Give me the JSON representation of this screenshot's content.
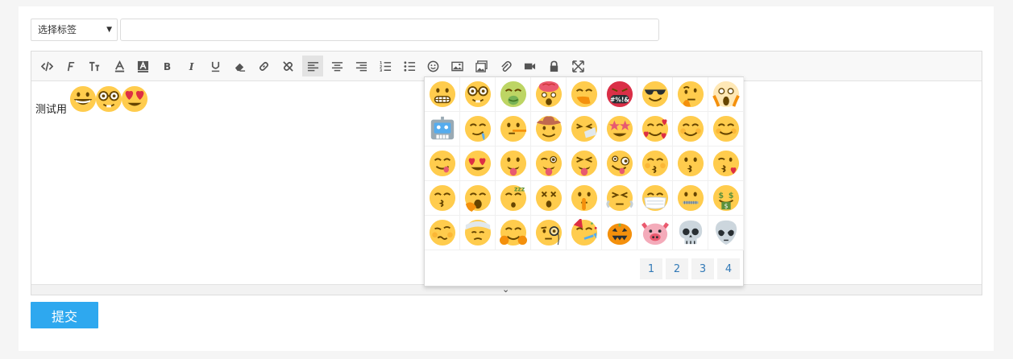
{
  "form": {
    "tag_select": {
      "selected": "选择标签",
      "caret": "▼"
    },
    "title_input": {
      "value": "",
      "placeholder": ""
    },
    "submit_label": "提交"
  },
  "toolbar": {
    "items": [
      {
        "name": "code-icon",
        "glyph": "</>"
      },
      {
        "name": "font-family-icon",
        "glyph": "F"
      },
      {
        "name": "font-size-icon",
        "glyph": "T↕"
      },
      {
        "name": "font-color-icon",
        "glyph": "A"
      },
      {
        "name": "background-color-icon",
        "glyph": "A"
      },
      {
        "name": "bold-icon",
        "glyph": "B"
      },
      {
        "name": "italic-icon",
        "glyph": "I"
      },
      {
        "name": "underline-icon",
        "glyph": "U"
      },
      {
        "name": "eraser-icon",
        "glyph": "⌫"
      },
      {
        "name": "link-icon",
        "glyph": "🔗"
      },
      {
        "name": "unlink-icon",
        "glyph": "⛓"
      },
      {
        "name": "align-left-icon",
        "glyph": "≡"
      },
      {
        "name": "align-center-icon",
        "glyph": "≡"
      },
      {
        "name": "align-right-icon",
        "glyph": "≡"
      },
      {
        "name": "ordered-list-icon",
        "glyph": "1≡"
      },
      {
        "name": "unordered-list-icon",
        "glyph": "•≡"
      },
      {
        "name": "emoji-icon",
        "glyph": "☺"
      },
      {
        "name": "image-icon",
        "glyph": "▣"
      },
      {
        "name": "gallery-icon",
        "glyph": "▤"
      },
      {
        "name": "attachment-icon",
        "glyph": "📎"
      },
      {
        "name": "video-icon",
        "glyph": "■"
      },
      {
        "name": "lock-icon",
        "glyph": "🔒"
      },
      {
        "name": "fullscreen-icon",
        "glyph": "⤢"
      }
    ],
    "active": "align-left-icon"
  },
  "content": {
    "text": "测试用",
    "inserted_emojis": [
      "grinning-face",
      "nerd-face",
      "heart-eyes-face"
    ]
  },
  "emoji_popup": {
    "rows": [
      [
        "grimacing",
        "nerd",
        "nauseated",
        "exploding-head",
        "hand-over-mouth",
        "cursing",
        "sunglasses",
        "thinking",
        "screaming"
      ],
      [
        "robot",
        "drooling",
        "lying",
        "cowboy",
        "sneezing",
        "star-struck",
        "smiling-hearts",
        "smiling-blush",
        "smiling"
      ],
      [
        "yum",
        "heart-eyes",
        "tongue-out",
        "winking-tongue",
        "squinting-tongue",
        "zany",
        "kissing-closed-eyes",
        "kissing",
        "blowing-kiss"
      ],
      [
        "kissing-smiling-eyes",
        "yawning",
        "sleeping",
        "dizzy",
        "shushing",
        "steam-nose",
        "mask",
        "zipper-mouth",
        "money-mouth"
      ],
      [
        "woozy",
        "bandaged-head",
        "hugging",
        "monocle",
        "partying",
        "jack-o-lantern",
        "pig",
        "skull",
        "alien"
      ]
    ],
    "pages": [
      "1",
      "2",
      "3",
      "4"
    ],
    "current_page": "1"
  },
  "colors": {
    "emoji_yellow": "#ffcc4d",
    "submit_blue": "#2ea8ef",
    "page_link_blue": "#337ab7"
  }
}
